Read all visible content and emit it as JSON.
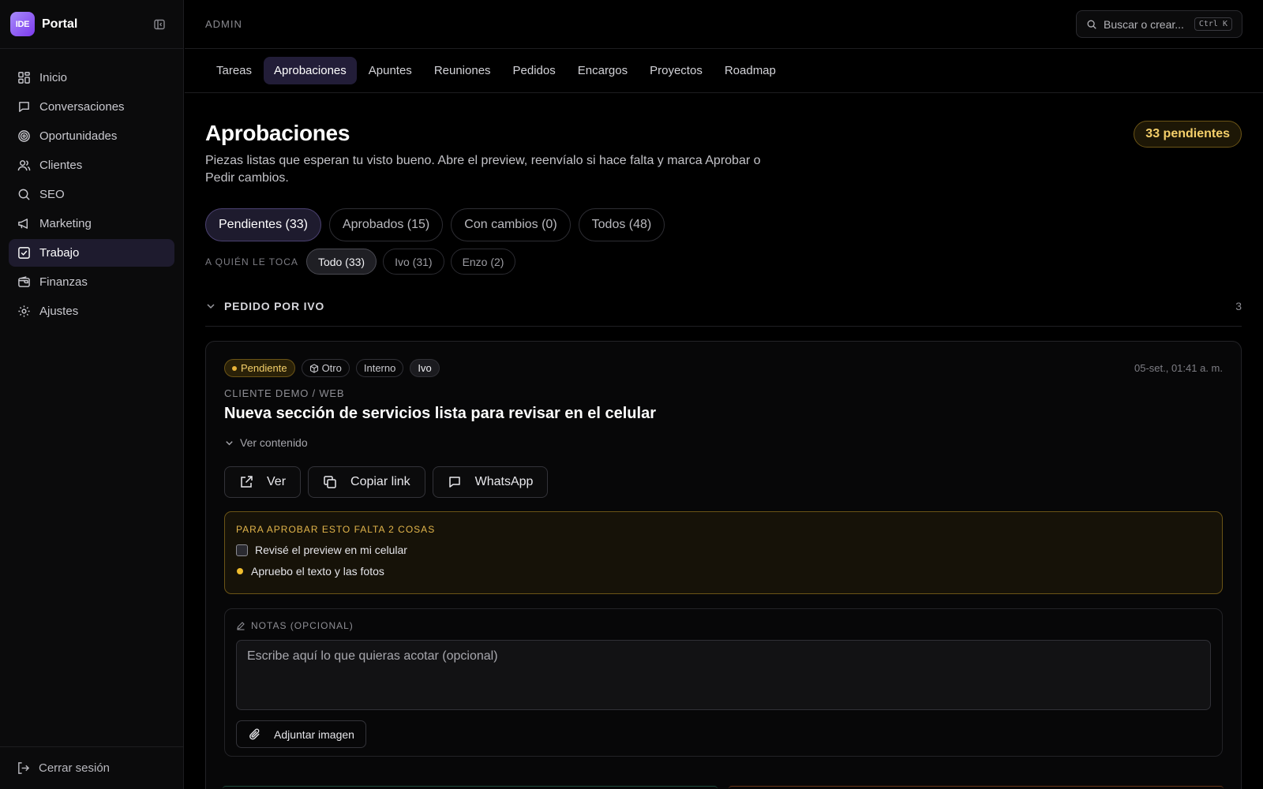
{
  "brand": {
    "logo": "IDE",
    "name": "Portal"
  },
  "sidebar": {
    "items": [
      {
        "label": "Inicio",
        "icon": "grid-icon"
      },
      {
        "label": "Conversaciones",
        "icon": "message-icon"
      },
      {
        "label": "Oportunidades",
        "icon": "target-icon"
      },
      {
        "label": "Clientes",
        "icon": "users-icon"
      },
      {
        "label": "SEO",
        "icon": "search-icon"
      },
      {
        "label": "Marketing",
        "icon": "megaphone-icon"
      },
      {
        "label": "Trabajo",
        "icon": "check-square-icon",
        "active": true
      },
      {
        "label": "Finanzas",
        "icon": "wallet-icon"
      },
      {
        "label": "Ajustes",
        "icon": "gear-icon"
      }
    ],
    "logout": "Cerrar sesión"
  },
  "topbar": {
    "section": "ADMIN",
    "search_placeholder": "Buscar o crear...",
    "shortcut": "Ctrl K"
  },
  "tabs": [
    "Tareas",
    "Aprobaciones",
    "Apuntes",
    "Reuniones",
    "Pedidos",
    "Encargos",
    "Proyectos",
    "Roadmap"
  ],
  "page": {
    "title": "Aprobaciones",
    "description": "Piezas listas que esperan tu visto bueno. Abre el preview, reenvíalo si hace falta y marca Aprobar o Pedir cambios.",
    "pending_badge": "33 pendientes"
  },
  "filters": [
    "Pendientes (33)",
    "Aprobados (15)",
    "Con cambios (0)",
    "Todos (48)"
  ],
  "assign": {
    "label": "A QUIÉN LE TOCA",
    "options": [
      "Todo (33)",
      "Ivo (31)",
      "Enzo (2)"
    ]
  },
  "group": {
    "title": "PEDIDO POR IVO",
    "count": "3"
  },
  "card": {
    "status": "Pendiente",
    "type": "Otro",
    "scope": "Interno",
    "owner": "Ivo",
    "date": "05-set., 01:41 a. m.",
    "path": "CLIENTE DEMO / WEB",
    "title": "Nueva sección de servicios lista para revisar en el celular",
    "see_content": "Ver contenido",
    "actions": {
      "view": "Ver",
      "copy": "Copiar link",
      "whatsapp": "WhatsApp"
    },
    "requirements": {
      "title": "PARA APROBAR ESTO FALTA 2 COSAS",
      "items": [
        "Revisé el preview en mi celular",
        "Apruebo el texto y las fotos"
      ]
    },
    "notes": {
      "label": "NOTAS (OPCIONAL)",
      "placeholder": "Escribe aquí lo que quieras acotar (opcional)",
      "attach": "Adjuntar imagen"
    }
  },
  "colors": {
    "accent": "#7c3aed",
    "pending": "#f4cf6a",
    "background": "#000000"
  }
}
